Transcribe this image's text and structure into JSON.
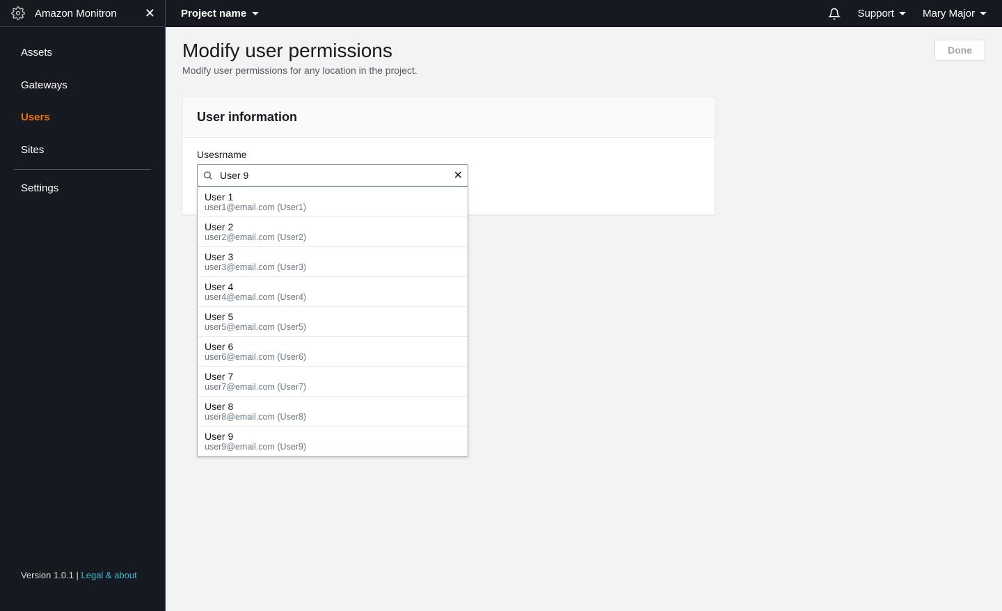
{
  "brand": {
    "name": "Amazon Monitron"
  },
  "project": {
    "label": "Project name"
  },
  "topbar": {
    "support": "Support",
    "user": "Mary Major"
  },
  "sidebar": {
    "items": [
      {
        "label": "Assets",
        "active": false
      },
      {
        "label": "Gateways",
        "active": false
      },
      {
        "label": "Users",
        "active": true
      },
      {
        "label": "Sites",
        "active": false
      }
    ],
    "settings": "Settings",
    "version_prefix": "Version 1.0.1 | ",
    "legal_link": "Legal & about"
  },
  "page": {
    "title": "Modify user permissions",
    "subtitle": "Modify user permissions for any location in the project.",
    "done": "Done"
  },
  "panel": {
    "title": "User information",
    "field_label": "Usesrname",
    "search_value": "User 9",
    "options": [
      {
        "name": "User 1",
        "sub": "user1@email.com (User1)"
      },
      {
        "name": "User 2",
        "sub": "user2@email.com (User2)"
      },
      {
        "name": "User 3",
        "sub": "user3@email.com (User3)"
      },
      {
        "name": "User 4",
        "sub": "user4@email.com (User4)"
      },
      {
        "name": "User 5",
        "sub": "user5@email.com (User5)"
      },
      {
        "name": "User 6",
        "sub": "user6@email.com (User6)"
      },
      {
        "name": "User 7",
        "sub": "user7@email.com (User7)"
      },
      {
        "name": "User 8",
        "sub": "user8@email.com (User8)"
      },
      {
        "name": "User 9",
        "sub": "user9@email.com (User9)"
      }
    ]
  }
}
